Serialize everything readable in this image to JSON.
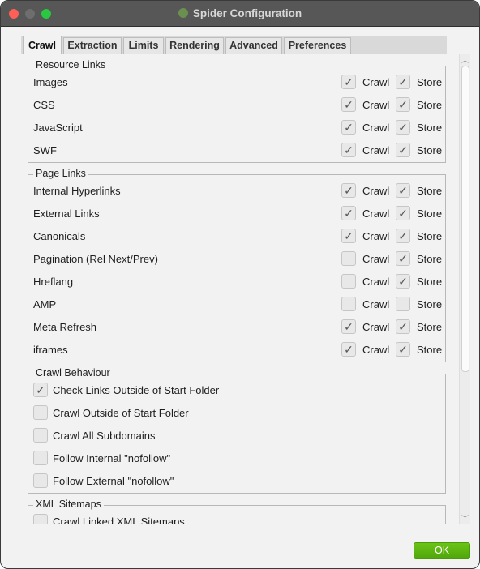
{
  "window": {
    "title": "Spider Configuration"
  },
  "tabs": [
    "Crawl",
    "Extraction",
    "Limits",
    "Rendering",
    "Advanced",
    "Preferences"
  ],
  "active_tab": "Crawl",
  "labels": {
    "crawl": "Crawl",
    "store": "Store"
  },
  "resource_links": {
    "title": "Resource Links",
    "items": [
      {
        "label": "Images",
        "crawl": true,
        "store": true
      },
      {
        "label": "CSS",
        "crawl": true,
        "store": true
      },
      {
        "label": "JavaScript",
        "crawl": true,
        "store": true
      },
      {
        "label": "SWF",
        "crawl": true,
        "store": true
      }
    ]
  },
  "page_links": {
    "title": "Page Links",
    "items": [
      {
        "label": "Internal Hyperlinks",
        "crawl": true,
        "store": true
      },
      {
        "label": "External Links",
        "crawl": true,
        "store": true
      },
      {
        "label": "Canonicals",
        "crawl": true,
        "store": true
      },
      {
        "label": "Pagination (Rel Next/Prev)",
        "crawl": false,
        "store": true
      },
      {
        "label": "Hreflang",
        "crawl": false,
        "store": true
      },
      {
        "label": "AMP",
        "crawl": false,
        "store": false
      },
      {
        "label": "Meta Refresh",
        "crawl": true,
        "store": true
      },
      {
        "label": "iframes",
        "crawl": true,
        "store": true
      }
    ]
  },
  "crawl_behaviour": {
    "title": "Crawl Behaviour",
    "items": [
      {
        "label": "Check Links Outside of Start Folder",
        "checked": true
      },
      {
        "label": "Crawl Outside of Start Folder",
        "checked": false
      },
      {
        "label": "Crawl All Subdomains",
        "checked": false
      },
      {
        "label": "Follow Internal \"nofollow\"",
        "checked": false
      },
      {
        "label": "Follow External \"nofollow\"",
        "checked": false
      }
    ]
  },
  "xml_sitemaps": {
    "title": "XML Sitemaps",
    "items": [
      {
        "label": "Crawl Linked XML Sitemaps",
        "checked": false
      }
    ]
  },
  "ok_label": "OK",
  "colors": {
    "ok_button": "#5cb512",
    "titlebar": "#575757"
  }
}
